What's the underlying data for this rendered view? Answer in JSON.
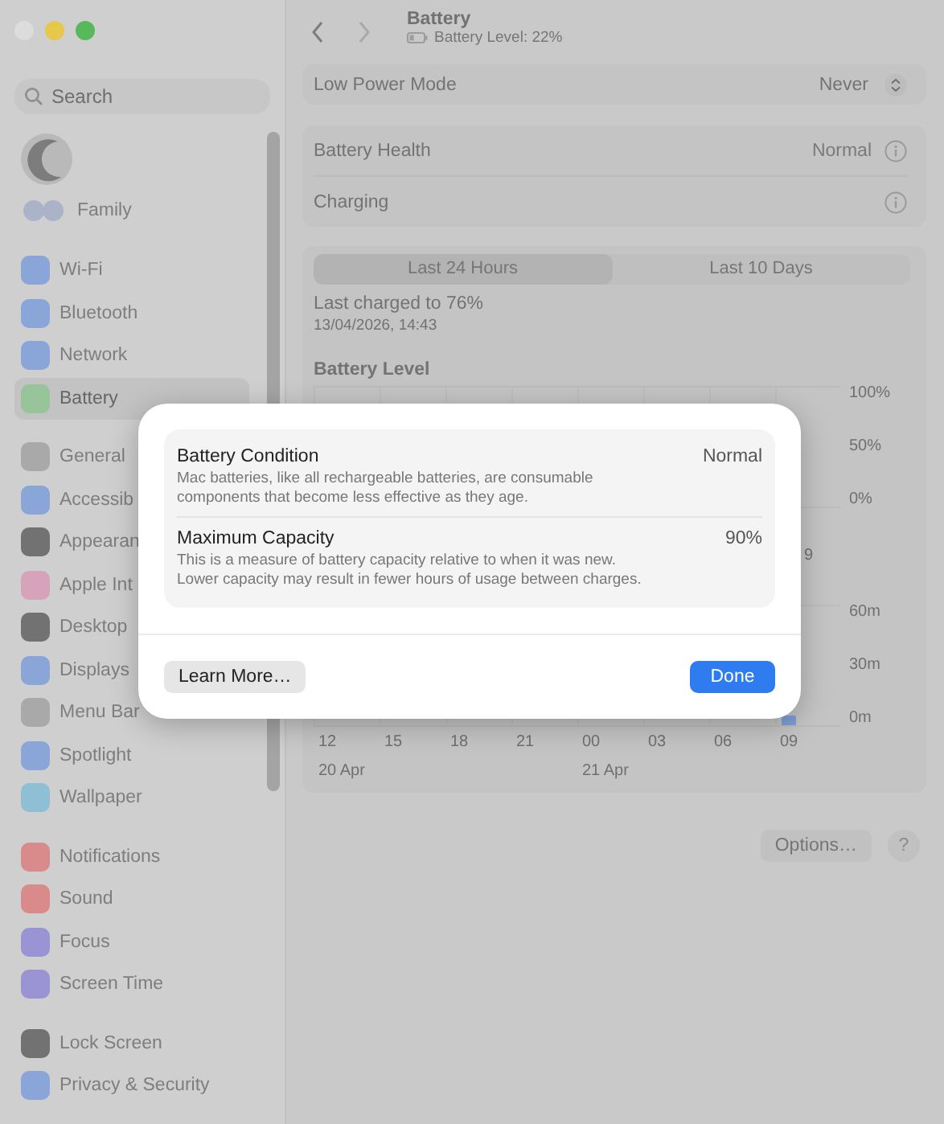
{
  "sidebar": {
    "search": {
      "placeholder": "Search"
    },
    "family_label": "Family",
    "groups": [
      [
        {
          "label": "Wi-Fi",
          "color": "#8aa6d8",
          "selected": false
        },
        {
          "label": "Bluetooth",
          "color": "#8aa6d8",
          "selected": false
        },
        {
          "label": "Network",
          "color": "#8aa6d8",
          "selected": false
        },
        {
          "label": "Battery",
          "color": "#98c49a",
          "selected": true
        }
      ],
      [
        {
          "label": "General",
          "color": "#a9a9a9",
          "selected": false
        },
        {
          "label": "Accessib",
          "color": "#8aa6d8",
          "selected": false
        },
        {
          "label": "Appearan",
          "color": "#727272",
          "selected": false
        },
        {
          "label": "Apple Int",
          "color": "#d7a3bb",
          "selected": false
        },
        {
          "label": "Desktop",
          "color": "#727272",
          "selected": false
        },
        {
          "label": "Displays",
          "color": "#8aa6d8",
          "selected": false
        },
        {
          "label": "Menu Bar",
          "color": "#a9a9a9",
          "selected": false
        },
        {
          "label": "Spotlight",
          "color": "#8aa6d8",
          "selected": false
        },
        {
          "label": "Wallpaper",
          "color": "#8fbfd4",
          "selected": false
        }
      ],
      [
        {
          "label": "Notifications",
          "color": "#d98a8a",
          "selected": false
        },
        {
          "label": "Sound",
          "color": "#d98a8a",
          "selected": false
        },
        {
          "label": "Focus",
          "color": "#9a94d4",
          "selected": false
        },
        {
          "label": "Screen Time",
          "color": "#9a94d4",
          "selected": false
        }
      ],
      [
        {
          "label": "Lock Screen",
          "color": "#727272",
          "selected": false
        },
        {
          "label": "Privacy & Security",
          "color": "#8aa6d8",
          "selected": false
        }
      ]
    ]
  },
  "header": {
    "title": "Battery",
    "subtitle": "Battery Level: 22%"
  },
  "low_power": {
    "label": "Low Power Mode",
    "value": "Never"
  },
  "health_rows": [
    {
      "label": "Battery Health",
      "value": "Normal"
    },
    {
      "label": "Charging"
    }
  ],
  "segments": [
    {
      "label": "Last 24 Hours",
      "selected": true
    },
    {
      "label": "Last 10 Days",
      "selected": false
    }
  ],
  "last_charged": {
    "title": "Last charged to 76%",
    "date": "13/04/2026, 14:43"
  },
  "battery_level_chart": {
    "title": "Battery Level",
    "y_labels": [
      "100%",
      "50%",
      "0%"
    ],
    "x_label_partial": "9"
  },
  "usage_chart": {
    "y_labels": [
      "60m",
      "30m",
      "0m"
    ],
    "x_labels": [
      "12",
      "15",
      "18",
      "21",
      "00",
      "03",
      "06",
      "09"
    ],
    "date_labels": [
      "20 Apr",
      "21 Apr"
    ]
  },
  "footer": {
    "options": "Options…",
    "help": "?"
  },
  "dialog": {
    "rows": [
      {
        "title": "Battery Condition",
        "value": "Normal",
        "description": "Mac batteries, like all rechargeable batteries, are consumable components that become less effective as they age."
      },
      {
        "title": "Maximum Capacity",
        "value": "90%",
        "description": "This is a measure of battery capacity relative to when it was new. Lower capacity may result in fewer hours of usage between charges."
      }
    ],
    "buttons": [
      {
        "label": "Learn More…",
        "kind": "secondary"
      },
      {
        "label": "Done",
        "kind": "primary"
      }
    ]
  }
}
